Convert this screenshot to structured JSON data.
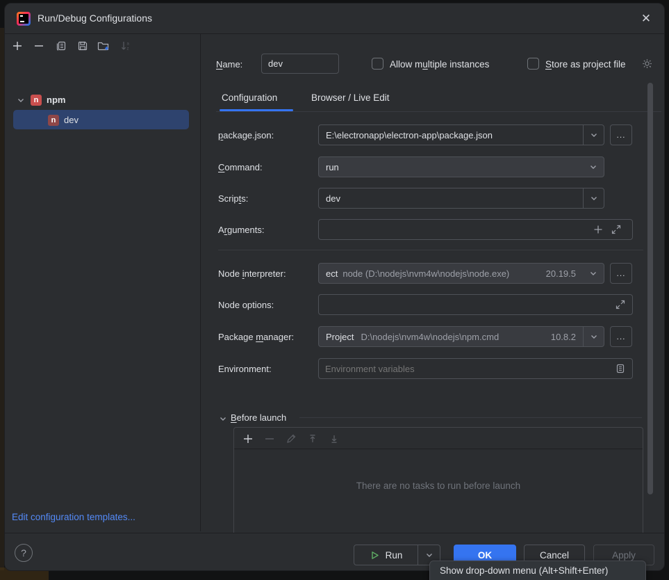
{
  "window": {
    "title": "Run/Debug Configurations",
    "close": "✕"
  },
  "sidebar": {
    "tree": {
      "root_label": "npm",
      "root_icon": "n",
      "child_label": "dev"
    },
    "edit_templates_link": "Edit configuration templates..."
  },
  "header": {
    "name_label": {
      "pre": "",
      "key": "N",
      "post": "ame:"
    },
    "name_value": "dev",
    "allow_multiple_label": {
      "pre": "Allow m",
      "key": "u",
      "post": "ltiple instances"
    },
    "store_project_label": {
      "pre": "",
      "key": "S",
      "post": "tore as project file"
    }
  },
  "tabs": {
    "configuration": "Configuration",
    "browser": "Browser / Live Edit"
  },
  "form": {
    "package_json": {
      "label": {
        "pre": "",
        "key": "p",
        "post": "ackage.json:"
      },
      "value": "E:\\electronapp\\electron-app\\package.json"
    },
    "command": {
      "label": {
        "pre": "",
        "key": "C",
        "post": "ommand:"
      },
      "value": "run"
    },
    "scripts": {
      "label": {
        "pre": "Scrip",
        "key": "t",
        "post": "s:"
      },
      "value": "dev"
    },
    "arguments": {
      "label": {
        "pre": "A",
        "key": "r",
        "post": "guments:"
      },
      "value": ""
    },
    "node_interpreter": {
      "label": {
        "pre": "Node ",
        "key": "i",
        "post": "nterpreter:"
      },
      "value_clipped": "ect",
      "value_path": "node (D:\\nodejs\\nvm4w\\nodejs\\node.exe)",
      "version": "20.19.5"
    },
    "node_options": {
      "label": "Node options:",
      "value": ""
    },
    "package_manager": {
      "label": {
        "pre": "Package ",
        "key": "m",
        "post": "anager:"
      },
      "value_name": "Project",
      "value_path": "D:\\nodejs\\nvm4w\\nodejs\\npm.cmd",
      "version": "10.8.2"
    },
    "environment": {
      "label": "Environment:",
      "placeholder": "Environment variables"
    },
    "browse_label": "..."
  },
  "before_launch": {
    "title": {
      "pre": "",
      "key": "B",
      "post": "efore launch"
    },
    "empty_text": "There are no tasks to run before launch"
  },
  "footer": {
    "help": "?",
    "run": "Run",
    "ok": "OK",
    "cancel": "Cancel",
    "apply": "Apply"
  },
  "tooltip": {
    "text": "Show drop-down menu (Alt+Shift+Enter)"
  },
  "colors": {
    "accent": "#3574f0",
    "selection": "#2e436e",
    "npm_red": "#c94f4e",
    "link": "#548af7"
  }
}
